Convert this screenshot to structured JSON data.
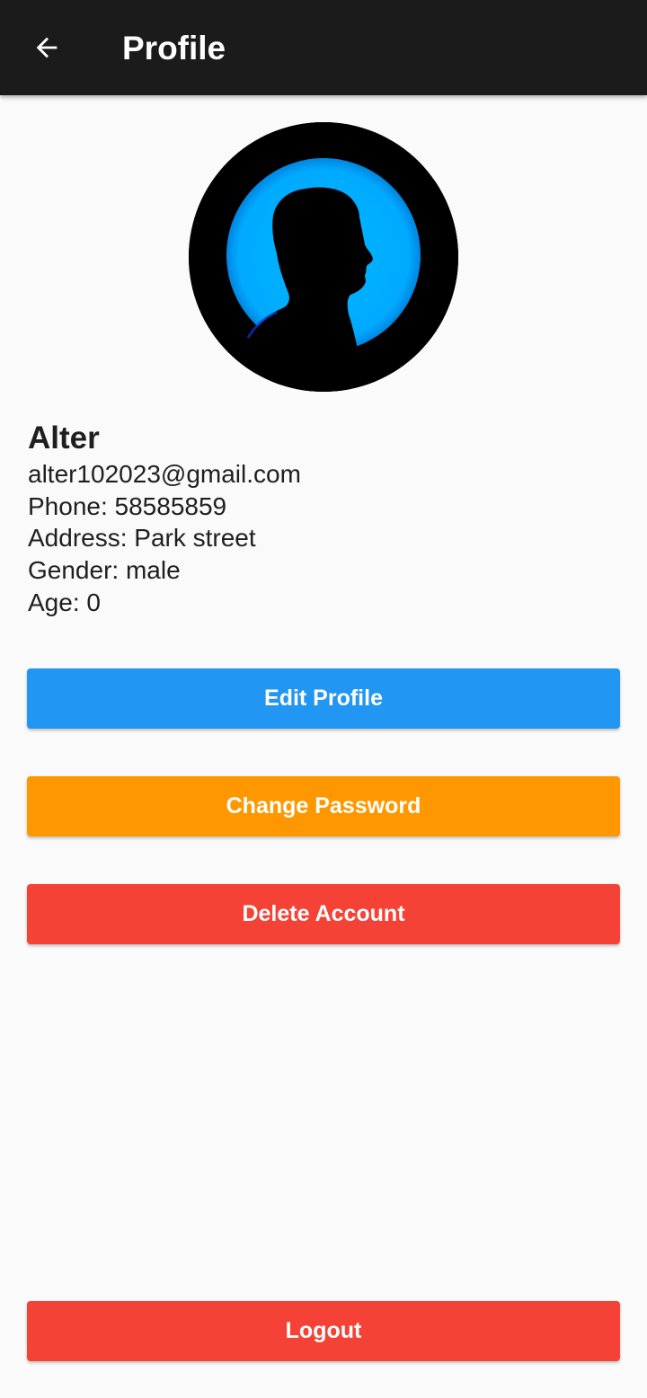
{
  "app_bar": {
    "title": "Profile",
    "back_icon": "arrow-left-icon"
  },
  "profile": {
    "avatar_icon": "person-silhouette-avatar",
    "name": "Alter",
    "email": "alter102023@gmail.com",
    "phone": "Phone: 58585859",
    "address": "Address: Park street",
    "gender": "Gender: male",
    "age": "Age: 0"
  },
  "actions": {
    "edit_label": "Edit Profile",
    "change_password_label": "Change Password",
    "delete_label": "Delete Account",
    "logout_label": "Logout"
  },
  "colors": {
    "app_bar": "#1b1b1b",
    "background": "#fafafa",
    "edit": "#2196f3",
    "change_password": "#ff9800",
    "delete": "#f44336",
    "logout": "#f44336",
    "avatar_glow": "#00aeff"
  }
}
